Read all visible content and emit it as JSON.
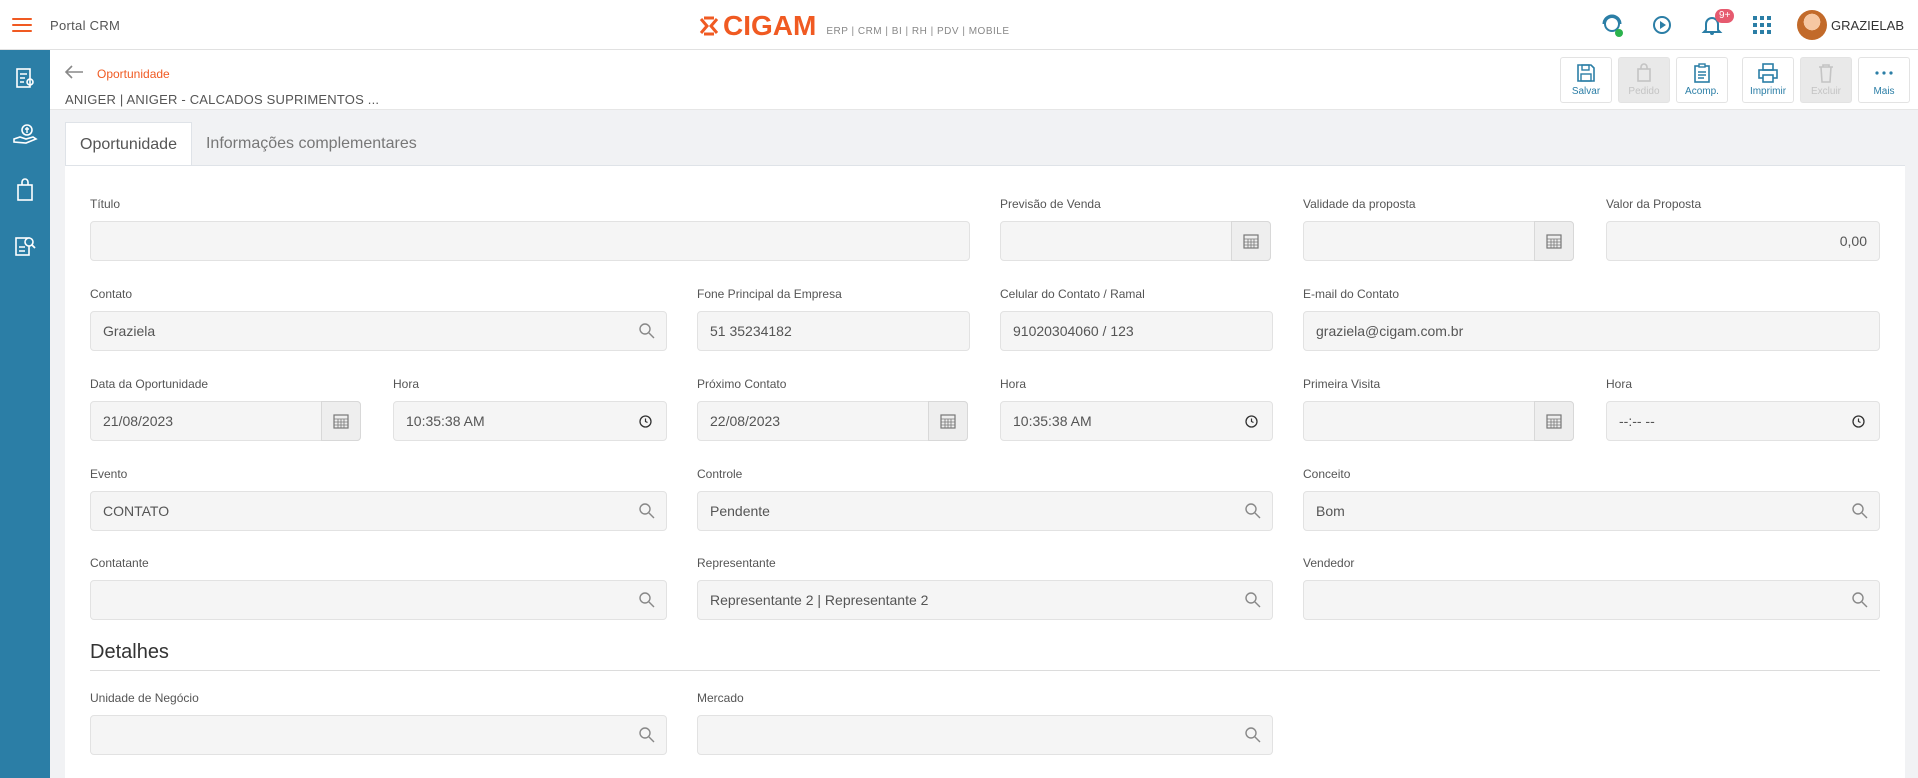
{
  "topbar": {
    "app_title": "Portal CRM",
    "brand": "CIGAM",
    "brand_sub": "ERP | CRM | BI | RH | PDV | MOBILE",
    "notification_count": "9+",
    "username": "GRAZIELAB"
  },
  "header": {
    "breadcrumb": "Oportunidade",
    "title": "ANIGER | ANIGER - CALCADOS SUPRIMENTOS ..."
  },
  "toolbar": {
    "save": "Salvar",
    "order": "Pedido",
    "follow": "Acomp.",
    "print": "Imprimir",
    "delete": "Excluir",
    "more": "Mais"
  },
  "tabs": [
    "Oportunidade",
    "Informações complementares"
  ],
  "form": {
    "titulo": {
      "label": "Título",
      "value": ""
    },
    "previsao": {
      "label": "Previsão de Venda",
      "value": ""
    },
    "validade": {
      "label": "Validade da proposta",
      "value": ""
    },
    "valor": {
      "label": "Valor da Proposta",
      "value": "0,00"
    },
    "contato": {
      "label": "Contato",
      "value": "Graziela"
    },
    "fone": {
      "label": "Fone Principal da Empresa",
      "value": "51 35234182"
    },
    "celular": {
      "label": "Celular do Contato / Ramal",
      "value": "91020304060 / 123"
    },
    "email": {
      "label": "E-mail do Contato",
      "value": "graziela@cigam.com.br"
    },
    "data_oportunidade": {
      "label": "Data da Oportunidade",
      "value": "21/08/2023"
    },
    "hora1": {
      "label": "Hora",
      "value": "10:35:38  AM"
    },
    "proximo_contato": {
      "label": "Próximo Contato",
      "value": "22/08/2023"
    },
    "hora2": {
      "label": "Hora",
      "value": "10:35:38  AM"
    },
    "primeira_visita": {
      "label": "Primeira Visita",
      "value": ""
    },
    "hora3": {
      "label": "Hora",
      "value": "--:-- --"
    },
    "evento": {
      "label": "Evento",
      "value": "CONTATO"
    },
    "controle": {
      "label": "Controle",
      "value": "Pendente"
    },
    "conceito": {
      "label": "Conceito",
      "value": "Bom"
    },
    "contatante": {
      "label": "Contatante",
      "value": ""
    },
    "representante": {
      "label": "Representante",
      "value": "Representante 2 | Representante 2"
    },
    "vendedor": {
      "label": "Vendedor",
      "value": ""
    }
  },
  "detalhes": {
    "heading": "Detalhes",
    "unidade": {
      "label": "Unidade de Negócio",
      "value": ""
    },
    "mercado": {
      "label": "Mercado",
      "value": ""
    }
  },
  "colors": {
    "accent": "#f05a22",
    "sidebar": "#2b7ea6"
  }
}
